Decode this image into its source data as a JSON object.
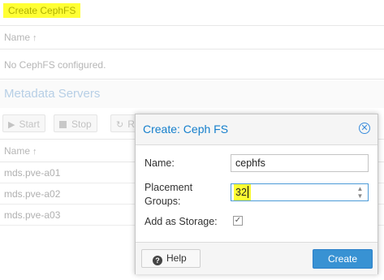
{
  "background": {
    "create_button_label": "Create CephFS",
    "cephfs_grid": {
      "column_name": "Name",
      "empty_text": "No CephFS configured."
    },
    "mds_section": {
      "title": "Metadata Servers",
      "toolbar": {
        "start_label": "Start",
        "stop_label": "Stop",
        "restart_label": "R"
      },
      "column_name": "Name",
      "rows": [
        "mds.pve-a01",
        "mds.pve-a02",
        "mds.pve-a03"
      ]
    }
  },
  "dialog": {
    "title": "Create: Ceph FS",
    "fields": {
      "name_label": "Name:",
      "name_value": "cephfs",
      "pg_label_line1": "Placement",
      "pg_label_line2": "Groups:",
      "pg_value": "32",
      "storage_label": "Add as Storage:",
      "storage_checked": true
    },
    "help_label": "Help",
    "create_label": "Create"
  },
  "colors": {
    "highlight": "#ffff34",
    "accent": "#157fcc",
    "primary_button": "#3892d3"
  }
}
